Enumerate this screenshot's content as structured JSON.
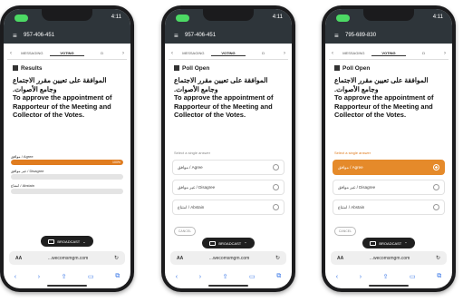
{
  "phones": [
    {
      "status_pill": "",
      "status_right": "4:11",
      "url_number": "957-406-451",
      "tabs": [
        "MESSAGING",
        "VOTING",
        "D"
      ],
      "section": "Results",
      "question_ar": "الموافقة على تعيين مقرر الاجتماع وجامع الأصوات.",
      "question_en": "To approve the appointment of Rapporteur of the Meeting and Collector of the Votes.",
      "results": [
        {
          "label": "موافق / Agree",
          "percent": 100,
          "pct_text": "100%"
        },
        {
          "label": "غير موافق / Disagree",
          "percent": 0,
          "pct_text": "0%"
        },
        {
          "label": "امتناع / Abstain",
          "percent": 0,
          "pct_text": "0%"
        }
      ],
      "broadcast": "BROADCAST",
      "address": "...wecomsmgm.com",
      "aa": "AA"
    },
    {
      "status_right": "4:11",
      "url_number": "957-406-451",
      "tabs": [
        "MESSAGING",
        "VOTING",
        "D"
      ],
      "section": "Poll Open",
      "question_ar": "الموافقة على تعيين مقرر الاجتماع وجامع الأصوات.",
      "question_en": "To approve the appointment of Rapporteur of the Meeting and Collector of the Votes.",
      "hint": "Select a single answer",
      "options": [
        "موافق / Agree",
        "غير موافق / Disagree",
        "امتناع / Abstain"
      ],
      "cancel": "CANCEL",
      "broadcast": "BROADCAST",
      "address": "...wecomsmgm.com",
      "aa": "AA"
    },
    {
      "status_right": "4:11",
      "url_number": "795-689-830",
      "tabs": [
        "MESSAGING",
        "VOTING",
        "D"
      ],
      "section": "Poll Open",
      "question_ar": "الموافقة على تعيين مقرر الاجتماع وجامع الأصوات.",
      "question_en": "To approve the appointment of Rapporteur of the Meeting and Collector of the Votes.",
      "hint": "Select a single answer",
      "options": [
        "موافق / Agree",
        "غير موافق / Disagree",
        "امتناع / Abstain"
      ],
      "cancel": "CANCEL",
      "broadcast": "BROADCAST",
      "address": "...wecomsmgm.com",
      "aa": "AA"
    }
  ],
  "colors": {
    "accent": "#e07c1f",
    "status_bg": "#2e353a",
    "pill": "#4cd964"
  },
  "icons": {
    "menu": "menu-icon",
    "back": "back-icon",
    "forward": "forward-icon",
    "share": "share-icon",
    "book": "book-icon",
    "tabs": "tabs-icon",
    "reload": "reload-icon"
  }
}
